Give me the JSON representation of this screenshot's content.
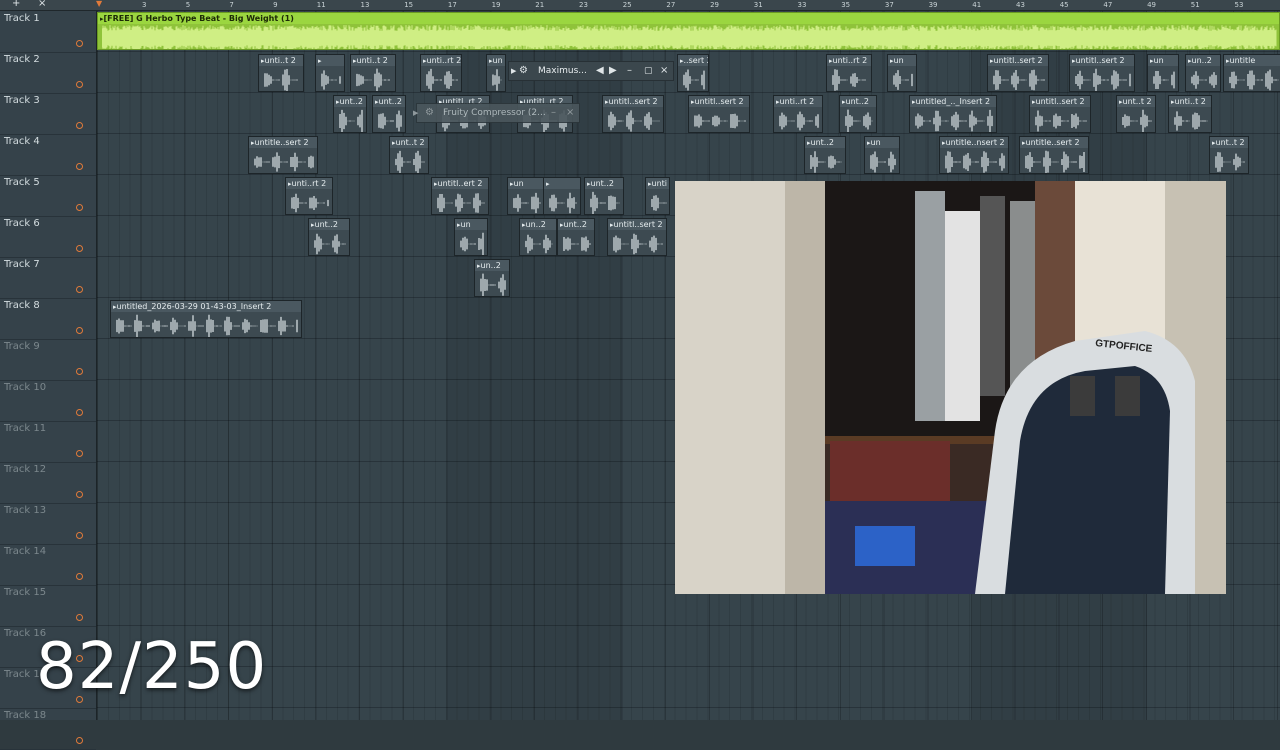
{
  "toolbar": {
    "add_icon": "+",
    "close_icon": "×"
  },
  "ruler_marks": [
    "3",
    "5",
    "7",
    "9",
    "11",
    "13",
    "15",
    "17",
    "19",
    "21",
    "23",
    "25",
    "27",
    "29",
    "31",
    "33",
    "35",
    "37",
    "39",
    "41",
    "43",
    "45",
    "47",
    "49",
    "51",
    "53"
  ],
  "tracks": [
    {
      "name": "Track 1",
      "dim": false
    },
    {
      "name": "Track 2",
      "dim": false
    },
    {
      "name": "Track 3",
      "dim": false
    },
    {
      "name": "Track 4",
      "dim": false
    },
    {
      "name": "Track 5",
      "dim": false
    },
    {
      "name": "Track 6",
      "dim": false
    },
    {
      "name": "Track 7",
      "dim": false
    },
    {
      "name": "Track 8",
      "dim": false
    },
    {
      "name": "Track 9",
      "dim": true
    },
    {
      "name": "Track 10",
      "dim": true
    },
    {
      "name": "Track 11",
      "dim": true
    },
    {
      "name": "Track 12",
      "dim": true
    },
    {
      "name": "Track 13",
      "dim": true
    },
    {
      "name": "Track 14",
      "dim": true
    },
    {
      "name": "Track 15",
      "dim": true
    },
    {
      "name": "Track 16",
      "dim": true
    },
    {
      "name": "Track 17",
      "dim": true
    },
    {
      "name": "Track 18",
      "dim": true
    }
  ],
  "main_clip": {
    "label": "[FREE] G Herbo Type Beat - Big Weight (1)"
  },
  "clips": [
    {
      "track": 1,
      "label": "unti..t 2"
    },
    {
      "track": 1,
      "label": ""
    },
    {
      "track": 1,
      "label": "unti..t 2"
    },
    {
      "track": 1,
      "label": "unti..rt 2"
    },
    {
      "track": 1,
      "label": "un"
    },
    {
      "track": 1,
      "label": "..sert 2"
    },
    {
      "track": 1,
      "label": "unti..rt 2"
    },
    {
      "track": 1,
      "label": "un"
    },
    {
      "track": 1,
      "label": "untitl..sert 2"
    },
    {
      "track": 1,
      "label": "untitl..sert 2"
    },
    {
      "track": 1,
      "label": "un"
    },
    {
      "track": 1,
      "label": "un..2"
    },
    {
      "track": 1,
      "label": "untitle"
    },
    {
      "track": 2,
      "label": "unt..2"
    },
    {
      "track": 2,
      "label": "unt..2"
    },
    {
      "track": 2,
      "label": "untitl..rt 2"
    },
    {
      "track": 2,
      "label": "untitl..rt 2"
    },
    {
      "track": 2,
      "label": "untitl..sert 2"
    },
    {
      "track": 2,
      "label": "untitl..sert 2"
    },
    {
      "track": 2,
      "label": "unti..rt 2"
    },
    {
      "track": 2,
      "label": "unt..2"
    },
    {
      "track": 2,
      "label": "untitled_.._Insert 2"
    },
    {
      "track": 2,
      "label": "untitl..sert 2"
    },
    {
      "track": 2,
      "label": "unt..t 2"
    },
    {
      "track": 2,
      "label": "unti..t 2"
    },
    {
      "track": 3,
      "label": "untitle..sert 2"
    },
    {
      "track": 3,
      "label": "unt..t 2"
    },
    {
      "track": 3,
      "label": "unt..2"
    },
    {
      "track": 3,
      "label": "un"
    },
    {
      "track": 3,
      "label": "untitle..nsert 2"
    },
    {
      "track": 3,
      "label": "untitle..sert 2"
    },
    {
      "track": 3,
      "label": "unt..t 2"
    },
    {
      "track": 4,
      "label": "unti..rt 2"
    },
    {
      "track": 4,
      "label": "untitl..ert 2"
    },
    {
      "track": 4,
      "label": "un"
    },
    {
      "track": 4,
      "label": ""
    },
    {
      "track": 4,
      "label": "unt..2"
    },
    {
      "track": 4,
      "label": "unti"
    },
    {
      "track": 5,
      "label": "unt..2"
    },
    {
      "track": 5,
      "label": "un"
    },
    {
      "track": 5,
      "label": "un..2"
    },
    {
      "track": 5,
      "label": "unt..2"
    },
    {
      "track": 5,
      "label": "untitl..sert 2"
    },
    {
      "track": 6,
      "label": "un..2"
    },
    {
      "track": 7,
      "label": "untitled_2026-03-29 01-43-03_Insert 2"
    }
  ],
  "floating_maximus": {
    "title": "Maximus..."
  },
  "floating_compressor": {
    "title": "Fruity Compressor (2..."
  },
  "webcam": {
    "chair_brand": "GTPOFFICE"
  },
  "counter": {
    "text": "82/250"
  }
}
